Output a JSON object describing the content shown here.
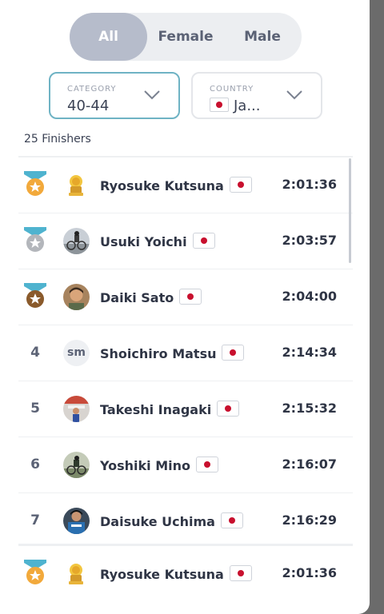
{
  "filters": {
    "gender_tabs": [
      "All",
      "Female",
      "Male"
    ],
    "active_tab": "All",
    "category": {
      "label": "CATEGORY",
      "value": "40-44"
    },
    "country": {
      "label": "COUNTRY",
      "value": "Ja..."
    }
  },
  "finishers_count": "25 Finishers",
  "results": [
    {
      "rank": "1",
      "medal": "gold",
      "avatar": "trophy-avatar",
      "name": "Ryosuke Kutsuna",
      "time": "2:01:36"
    },
    {
      "rank": "2",
      "medal": "silver",
      "avatar": "photo-avatar",
      "name": "Usuki Yoichi",
      "time": "2:03:57"
    },
    {
      "rank": "3",
      "medal": "bronze",
      "avatar": "photo-avatar",
      "name": "Daiki Sato",
      "time": "2:04:00"
    },
    {
      "rank": "4",
      "avatar": "initials-avatar",
      "initials": "sm",
      "name": "Shoichiro Matsu",
      "time": "2:14:34"
    },
    {
      "rank": "5",
      "avatar": "photo-avatar",
      "name": "Takeshi Inagaki",
      "time": "2:15:32"
    },
    {
      "rank": "6",
      "avatar": "photo-avatar",
      "name": "Yoshiki Mino",
      "time": "2:16:07"
    },
    {
      "rank": "7",
      "avatar": "photo-avatar",
      "name": "Daisuke Uchima",
      "time": "2:16:29"
    }
  ],
  "my_result": {
    "rank": "1",
    "medal": "gold",
    "avatar": "trophy-avatar",
    "name": "Ryosuke Kutsuna",
    "time": "2:01:36"
  },
  "colors": {
    "gold": "#f2a93b",
    "silver": "#b3b6bb",
    "bronze": "#8a5a2b",
    "ribbon": "#4fb3cf",
    "flag_red": "#c8102e",
    "accent_border": "#6fb3c4"
  }
}
